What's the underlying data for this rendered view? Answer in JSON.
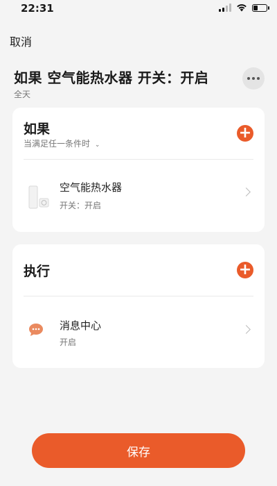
{
  "status_bar": {
    "time": "22:31"
  },
  "header": {
    "cancel_label": "取消"
  },
  "scene": {
    "title": "如果 空气能热水器 开关：开启",
    "subtitle": "全天"
  },
  "if_section": {
    "heading": "如果",
    "condition_mode": "当满足任一条件时",
    "items": [
      {
        "icon": "water-heater-icon",
        "title": "空气能热水器",
        "subtitle": "开关：开启"
      }
    ]
  },
  "do_section": {
    "heading": "执行",
    "items": [
      {
        "icon": "message-bubble-icon",
        "title": "消息中心",
        "subtitle": "开启"
      }
    ]
  },
  "footer": {
    "save_label": "保存"
  },
  "colors": {
    "accent": "#ea5b2a",
    "background": "#f4f4f4",
    "card": "#ffffff"
  }
}
